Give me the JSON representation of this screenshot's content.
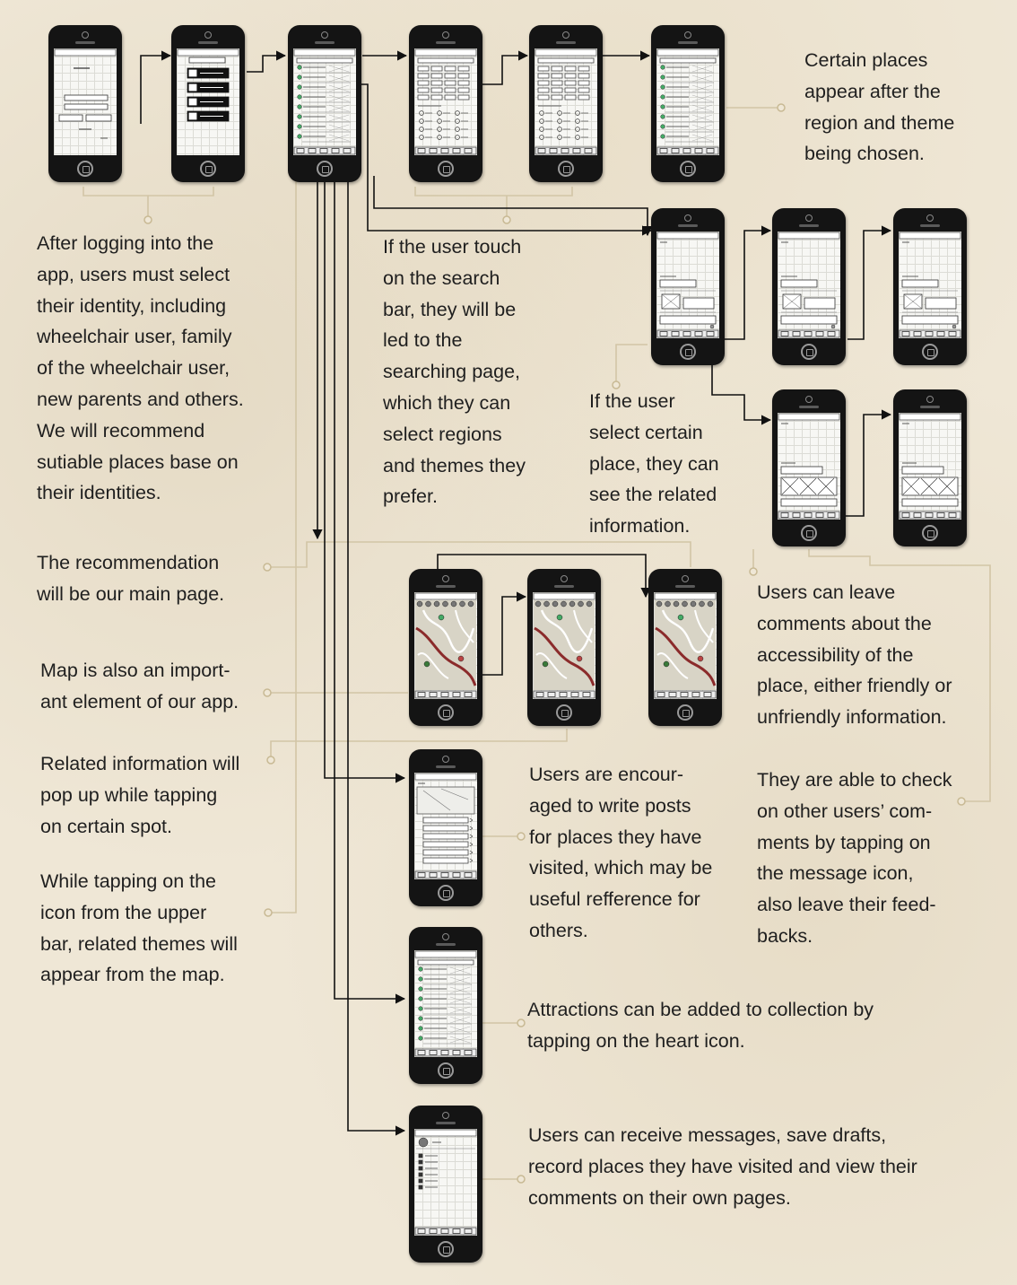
{
  "annotations": {
    "certain_places": "Certain places\nappear after the\nregion and theme\nbeing chosen.",
    "identity": "After logging into the\napp, users must select\ntheir identity, including\nwheelchair user, family\nof the wheelchair user,\nnew parents and others.\nWe will recommend\nsutiable places base on\ntheir identities.",
    "search": "If the user touch\non the search\nbar, they will be\nled to the\nsearching page,\nwhich they can\nselect regions\nand themes they\nprefer.",
    "select_place": "If the user\nselect certain\nplace, they can\nsee the related\ninformation.",
    "recommendation": "The recommendation\nwill be our main page.",
    "map": "Map is also an import-\nant element of our app.",
    "related_info": "Related information will\npop up while tapping\non certain spot.",
    "icon_themes": "While tapping on the\nicon from the upper\nbar, related themes will\nappear from the map.",
    "comments": "Users can leave\ncomments about the\naccessibility of the\nplace, either friendly or\nunfriendly information.",
    "posts": "Users are encour-\naged to write posts\nfor places they have\nvisited, which may be\nuseful refference for\nothers.",
    "check_comments": "They are able to check\non other users’ com-\nments by tapping on\nthe message icon,\nalso leave their feed-\nbacks.",
    "collection": "Attractions can be added to collection by\ntapping on the heart icon.",
    "messages": "Users can receive messages, save drafts,\nrecord places they have visited and view their\ncomments on their own pages."
  },
  "colors": {
    "background": "#efe7d6",
    "connector_line": "#d2c5a6",
    "arrow": "#111111",
    "phone_body": "#141414",
    "text": "#1f1f1f"
  },
  "screens": [
    {
      "id": "login",
      "sketch": "login"
    },
    {
      "id": "identity-select",
      "sketch": "identity"
    },
    {
      "id": "recommendation-list",
      "sketch": "list"
    },
    {
      "id": "search-page",
      "sketch": "search"
    },
    {
      "id": "search-page-selected",
      "sketch": "search"
    },
    {
      "id": "search-results",
      "sketch": "list"
    },
    {
      "id": "place-detail",
      "sketch": "detail"
    },
    {
      "id": "comment-write",
      "sketch": "detail"
    },
    {
      "id": "comment-posted",
      "sketch": "detail"
    },
    {
      "id": "place-comments",
      "sketch": "comments"
    },
    {
      "id": "comment-feedback",
      "sketch": "comments"
    },
    {
      "id": "map-main",
      "sketch": "map"
    },
    {
      "id": "map-popup",
      "sketch": "map"
    },
    {
      "id": "map-themes",
      "sketch": "map"
    },
    {
      "id": "posts",
      "sketch": "posts"
    },
    {
      "id": "collection",
      "sketch": "list"
    },
    {
      "id": "profile",
      "sketch": "profile"
    }
  ]
}
